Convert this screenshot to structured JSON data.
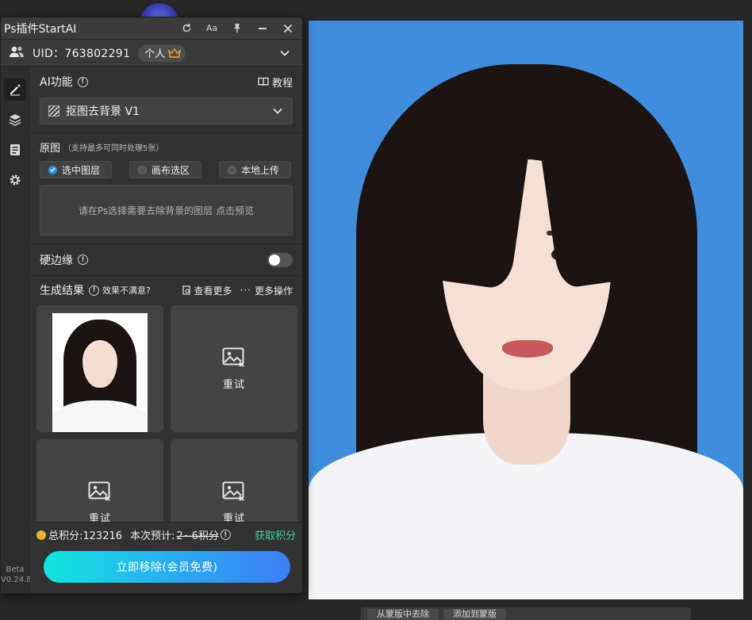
{
  "panel": {
    "title": "Ps插件StartAI",
    "version_line1": "Beta",
    "version_line2": "V0.24.8"
  },
  "user": {
    "uid_label": "UID：763802291",
    "plan": "个人"
  },
  "ai": {
    "label": "AI功能",
    "tutorial": "教程",
    "feature": "抠图去背景 V1"
  },
  "source": {
    "label": "原图",
    "tip": "（支持最多可同时处理5张）",
    "options": [
      "选中图层",
      "画布选区",
      "本地上传"
    ],
    "selected_index": 0,
    "hint": "请在Ps选择需要去除背景的图层",
    "preview_link": "点击预览"
  },
  "hard_edge": {
    "label": "硬边缘",
    "enabled": false
  },
  "results": {
    "label": "生成结果",
    "unsatisfied": "效果不满意?",
    "view_more": "查看更多",
    "more_ops": "更多操作",
    "retry": "重试"
  },
  "footer": {
    "total_points": "总积分:123216",
    "estimate_label": "本次预计:",
    "estimate_value": "2~6积分",
    "get_points": "获取积分",
    "cta": "立即移除(会员免费)"
  },
  "bottom_bar": {
    "btn1": "从蒙版中去除",
    "btn2": "添加到蒙版"
  },
  "colors": {
    "panel_bg": "#323232",
    "accent_blue": "#2f8ff0",
    "accent_green": "#35d3a2",
    "photo_bg": "#3f8ddc"
  }
}
